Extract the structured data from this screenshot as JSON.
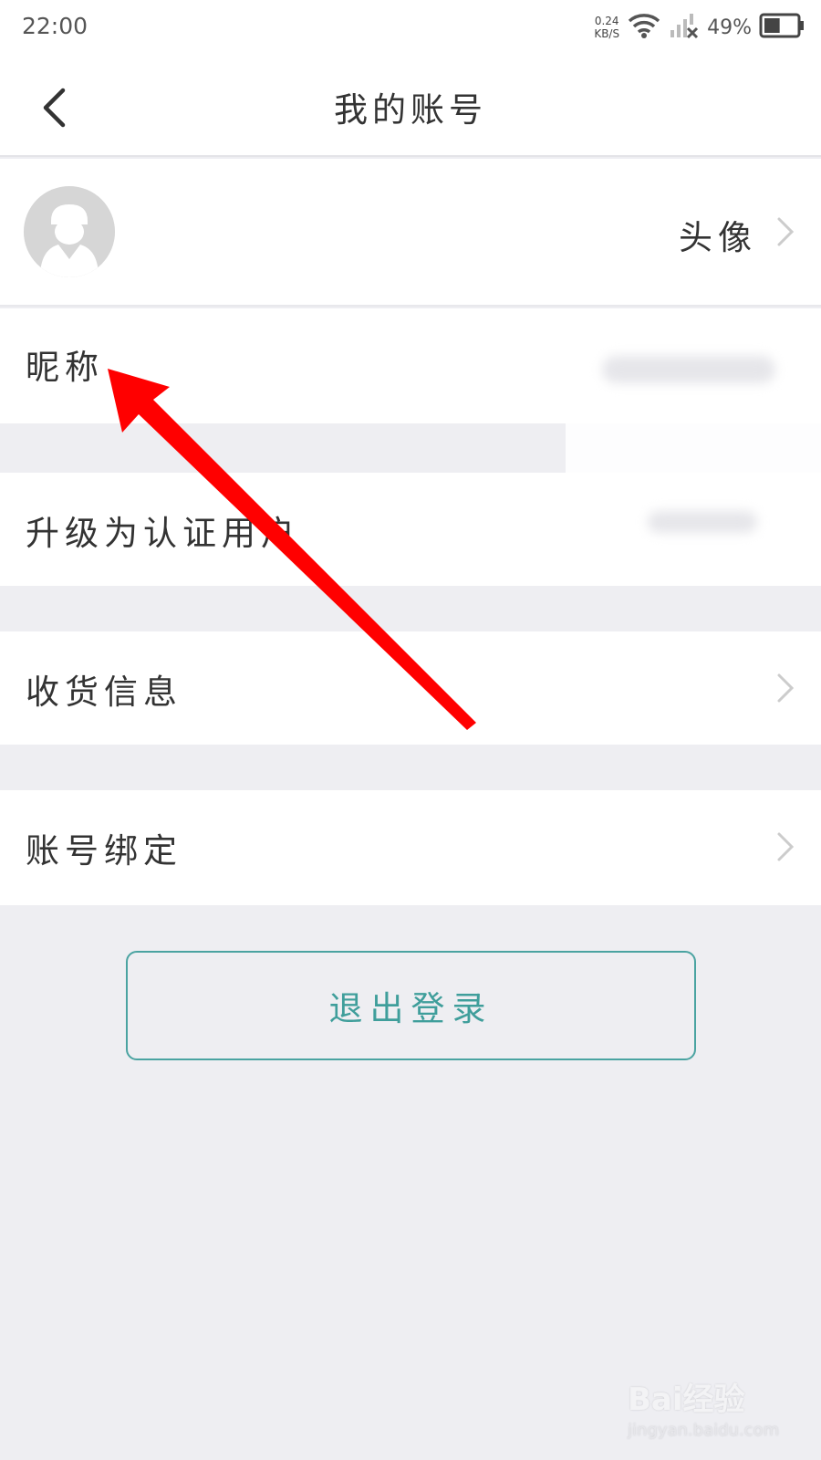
{
  "status_bar": {
    "time": "22:00",
    "net_speed_value": "0.24",
    "net_speed_unit": "KB/S",
    "battery_percent": "49%",
    "battery_level": 0.49
  },
  "nav": {
    "title": "我的账号"
  },
  "rows": {
    "avatar_label": "头像",
    "nickname_label": "昵称",
    "upgrade_label": "升级为认证用户",
    "shipping_label": "收货信息",
    "binding_label": "账号绑定"
  },
  "logout_label": "退出登录",
  "watermark": {
    "logo": "Bai经验",
    "url": "jingyan.baidu.com"
  },
  "colors": {
    "accent": "#3f9e9b",
    "annotation_arrow": "#ff0000",
    "background": "#eeeef2"
  }
}
